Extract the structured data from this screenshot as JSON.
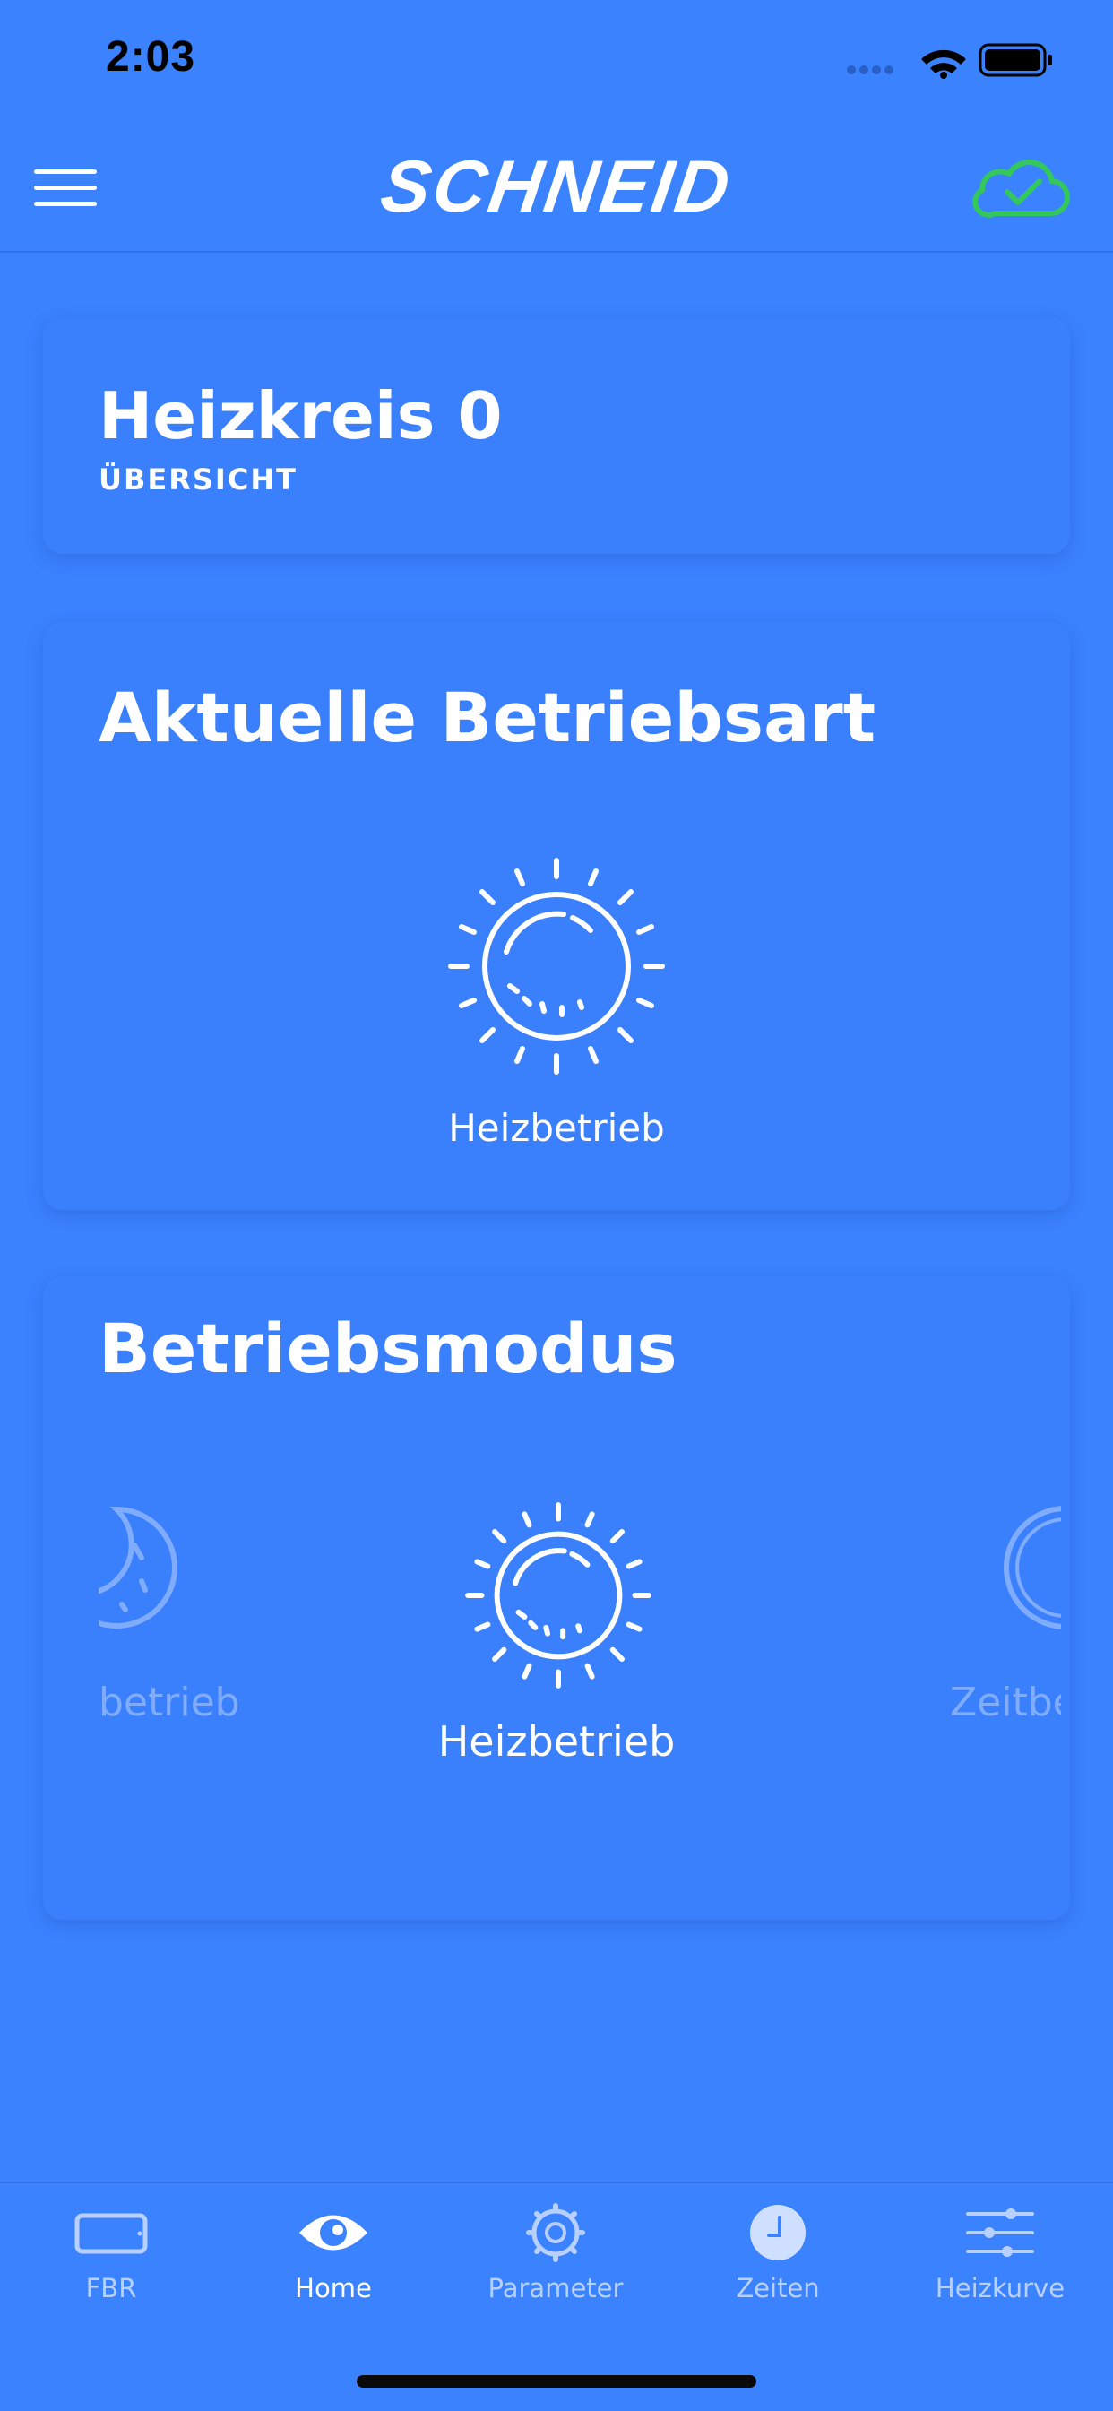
{
  "status_bar": {
    "time": "2:03"
  },
  "header": {
    "brand": "SCHNEID",
    "cloud_status_color": "#34c759"
  },
  "overview_card": {
    "title": "Heizkreis 0",
    "subtitle": "ÜBERSICHT"
  },
  "current_mode_card": {
    "title": "Aktuelle Betriebsart",
    "mode_label": "Heizbetrieb"
  },
  "operating_mode_card": {
    "title": "Betriebsmodus",
    "carousel": [
      {
        "label": "betrieb",
        "icon": "moon-icon"
      },
      {
        "label": "Heizbetrieb",
        "icon": "sun-icon"
      },
      {
        "label": "Zeitbe",
        "icon": "clock-icon"
      }
    ]
  },
  "tab_bar": {
    "items": [
      {
        "label": "FBR",
        "icon": "tablet-icon"
      },
      {
        "label": "Home",
        "icon": "eye-icon",
        "active": true
      },
      {
        "label": "Parameter",
        "icon": "gear-icon"
      },
      {
        "label": "Zeiten",
        "icon": "clock-icon"
      },
      {
        "label": "Heizkurve",
        "icon": "sliders-icon"
      }
    ]
  }
}
